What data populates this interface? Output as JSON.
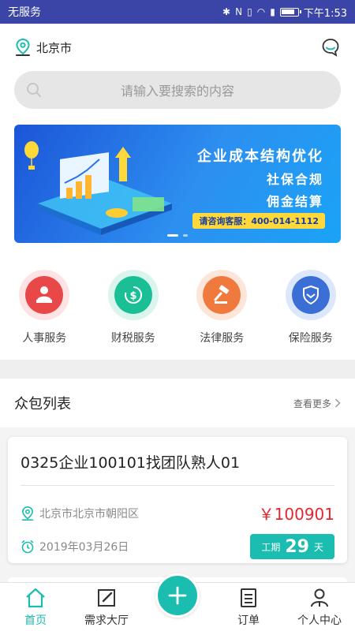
{
  "status_bar": {
    "carrier": "无服务",
    "time": "下午1:53",
    "icons": [
      "bluetooth-icon",
      "nfc-icon",
      "vibrate-icon",
      "wifi-icon",
      "sim-icon",
      "battery-icon"
    ]
  },
  "header": {
    "location": "北京市",
    "message_icon": "chat-bubble-icon"
  },
  "search": {
    "placeholder": "请输入要搜索的内容"
  },
  "banner": {
    "line1": "企业成本结构优化",
    "line2": "社保合规",
    "line3": "佣金结算",
    "hotline": "请咨询客服：400-014-1112",
    "active_slide": 1,
    "slide_count": 2
  },
  "services": [
    {
      "label": "人事服务",
      "icon": "person-icon",
      "color": "#e84848"
    },
    {
      "label": "财税服务",
      "icon": "dollar-cycle-icon",
      "color": "#1bbf96"
    },
    {
      "label": "法律服务",
      "icon": "gavel-icon",
      "color": "#f07a3e"
    },
    {
      "label": "保险服务",
      "icon": "shield-icon",
      "color": "#3b6fd6"
    }
  ],
  "crowd": {
    "title": "众包列表",
    "more": "查看更多",
    "items": [
      {
        "title": "0325企业100101找团队熟人01",
        "address": "北京市北京市朝阳区",
        "price": "￥100901",
        "date": "2019年03月26日",
        "period_label": "工期",
        "period_value": "29",
        "period_unit": "天"
      }
    ]
  },
  "tabbar": {
    "tabs": [
      {
        "label": "首页",
        "icon": "home-icon"
      },
      {
        "label": "需求大厅",
        "icon": "edit-icon"
      },
      {
        "label": "订单",
        "icon": "order-icon"
      },
      {
        "label": "个人中心",
        "icon": "user-icon"
      }
    ],
    "active_tab": 0,
    "fab_icon": "plus-icon"
  },
  "colors": {
    "accent": "#1bbdb0",
    "status_bar": "#3b44a7",
    "price": "#e8242e"
  }
}
